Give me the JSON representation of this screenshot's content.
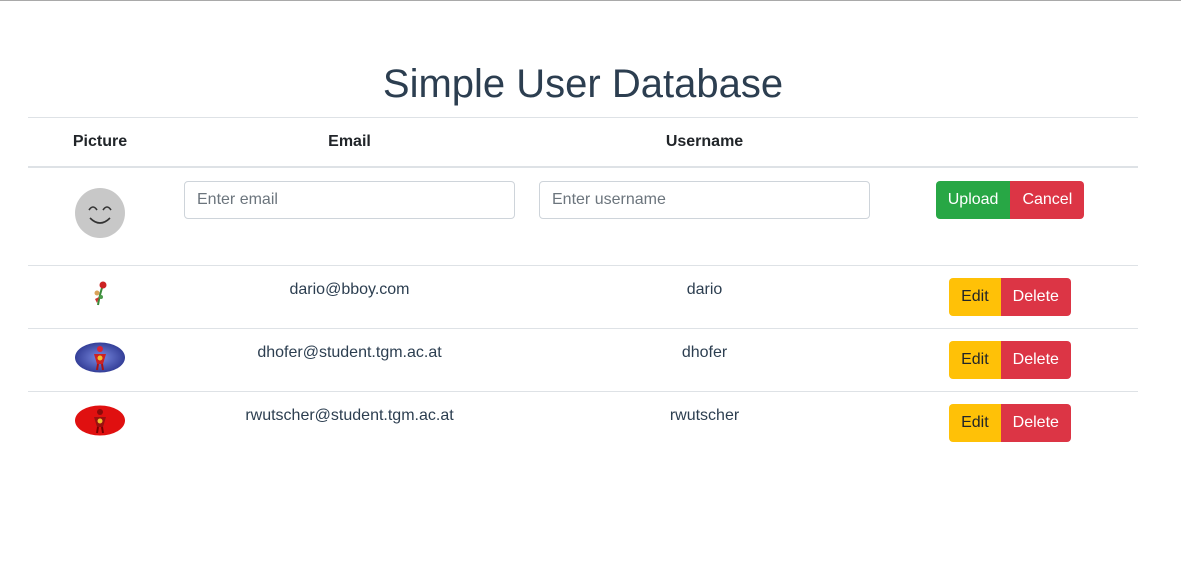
{
  "title": "Simple User Database",
  "table": {
    "headers": [
      "Picture",
      "Email",
      "Username",
      ""
    ],
    "new_row": {
      "avatar": "smiley-face-icon",
      "email_placeholder": "Enter email",
      "username_placeholder": "Enter username",
      "upload_label": "Upload",
      "cancel_label": "Cancel"
    },
    "rows": [
      {
        "avatar": "flower-figure-icon",
        "email": "dario@bboy.com",
        "username": "dario"
      },
      {
        "avatar": "blue-oval-figure-icon",
        "email": "dhofer@student.tgm.ac.at",
        "username": "dhofer"
      },
      {
        "avatar": "red-oval-figure-icon",
        "email": "rwutscher@student.tgm.ac.at",
        "username": "rwutscher"
      }
    ],
    "edit_label": "Edit",
    "delete_label": "Delete"
  },
  "colors": {
    "upload": "#28a745",
    "cancel": "#dc3545",
    "edit": "#ffc107",
    "delete": "#dc3545"
  }
}
